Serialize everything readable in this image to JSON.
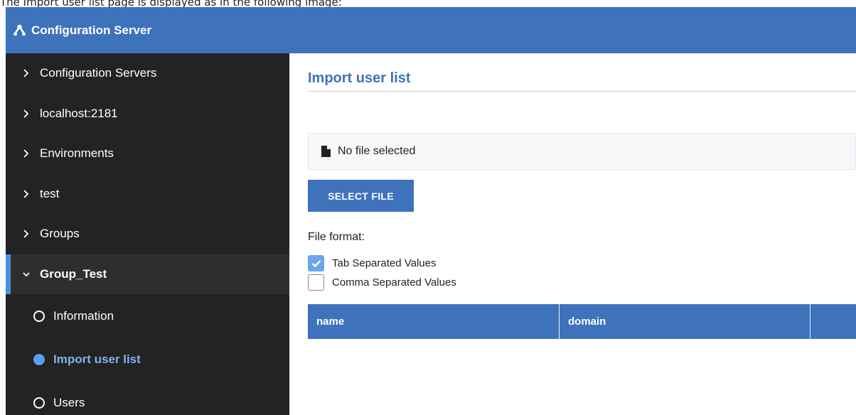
{
  "caption": "The Import user list page is displayed as in the following image:",
  "header": {
    "title": "Configuration Server",
    "logo_icon": "cluster-icon"
  },
  "sidebar": {
    "items": [
      {
        "label": "Configuration Servers"
      },
      {
        "label": "localhost:2181"
      },
      {
        "label": "Environments"
      },
      {
        "label": "test"
      },
      {
        "label": "Groups"
      },
      {
        "label": "Group_Test"
      }
    ],
    "subitems": [
      {
        "label": "Information",
        "active": false
      },
      {
        "label": "Import user list",
        "active": true
      },
      {
        "label": "Users",
        "active": false
      }
    ]
  },
  "main": {
    "title": "Import user list",
    "file_status": "No file selected",
    "select_button": "SELECT FILE",
    "format_label": "File format:",
    "formats": [
      {
        "label": "Tab Separated Values",
        "checked": true
      },
      {
        "label": "Comma Separated Values",
        "checked": false
      }
    ],
    "table": {
      "columns": [
        "name",
        "domain",
        ""
      ]
    }
  },
  "colors": {
    "accent": "#3e73bc",
    "sidebar_bg": "#232323",
    "active_sub": "#7fb2f0",
    "checkbox_checked": "#6aa6e8"
  }
}
